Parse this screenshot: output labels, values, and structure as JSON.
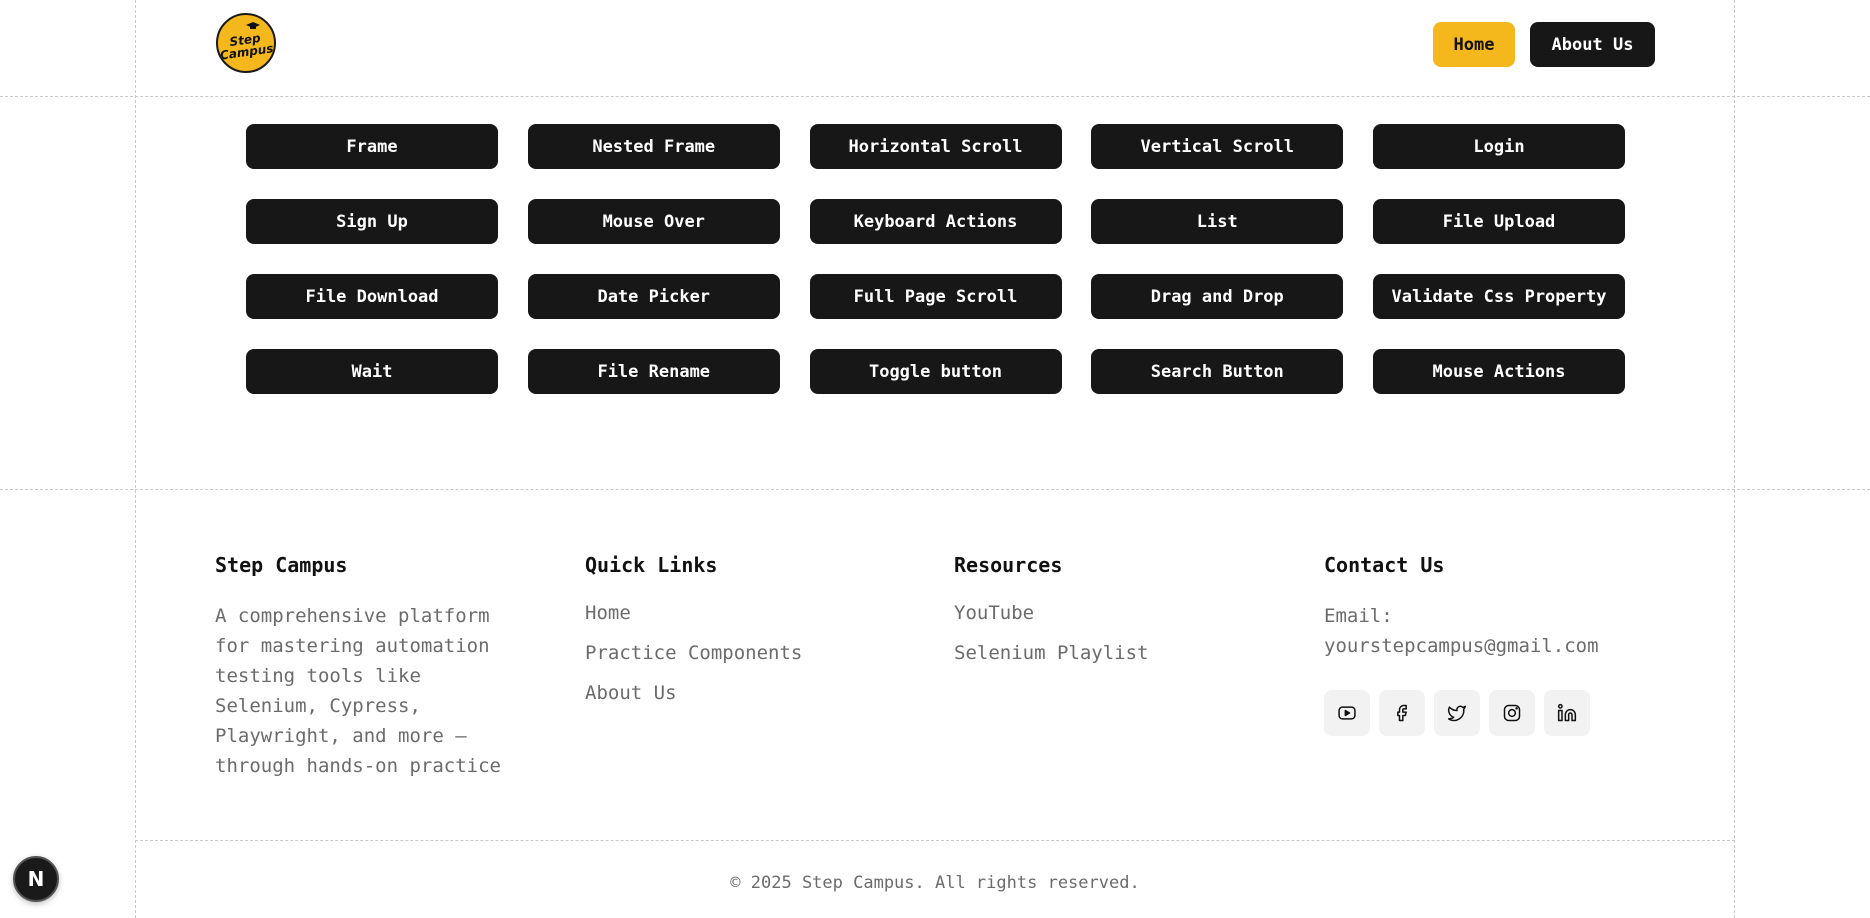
{
  "header": {
    "logo_text_line1": "Step",
    "logo_text_line2": "Campus",
    "nav": [
      {
        "label": "Home",
        "active": true
      },
      {
        "label": "About Us",
        "active": false
      }
    ]
  },
  "components": [
    "Frame",
    "Nested Frame",
    "Horizontal Scroll",
    "Vertical Scroll",
    "Login",
    "Sign Up",
    "Mouse Over",
    "Keyboard Actions",
    "List",
    "File Upload",
    "File Download",
    "Date Picker",
    "Full Page Scroll",
    "Drag and Drop",
    "Validate Css Property",
    "Wait",
    "File Rename",
    "Toggle button",
    "Search Button",
    "Mouse Actions"
  ],
  "footer": {
    "about": {
      "title": "Step Campus",
      "description": "A comprehensive platform for mastering automation testing tools like Selenium, Cypress, Playwright, and more — through hands-on practice"
    },
    "quick_links": {
      "title": "Quick Links",
      "links": [
        "Home",
        "Practice Components",
        "About Us"
      ]
    },
    "resources": {
      "title": "Resources",
      "links": [
        "YouTube",
        "Selenium Playlist"
      ]
    },
    "contact": {
      "title": "Contact Us",
      "email_label": "Email:",
      "email": "yourstepcampus@gmail.com",
      "socials": [
        "youtube-icon",
        "facebook-icon",
        "twitter-icon",
        "instagram-icon",
        "linkedin-icon"
      ]
    },
    "copyright": "© 2025 Step Campus. All rights reserved."
  },
  "dev_badge": "N",
  "colors": {
    "accent": "#f5b81c",
    "dark": "#171717",
    "muted_text": "#6b6b6b"
  }
}
